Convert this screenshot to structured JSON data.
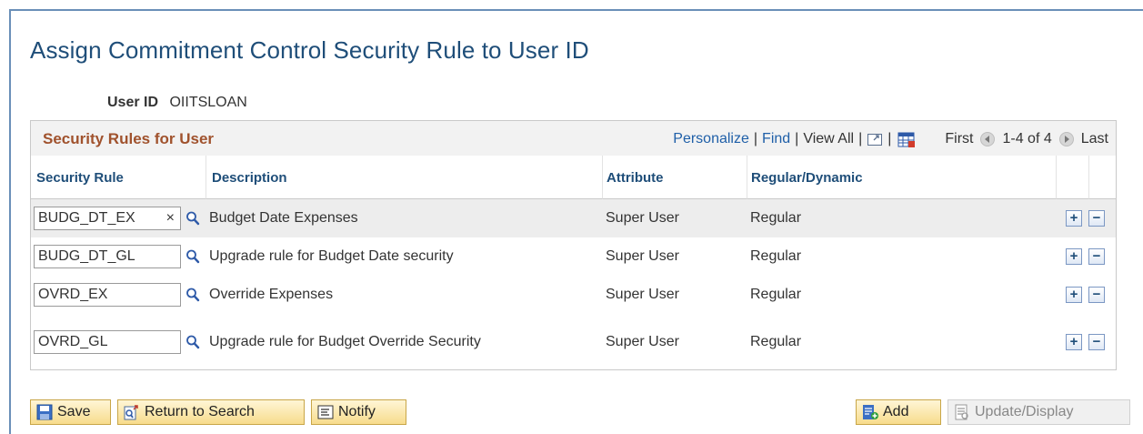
{
  "page": {
    "title": "Assign Commitment Control Security Rule to User ID",
    "user_id_label": "User ID",
    "user_id_value": "OIITSLOAN"
  },
  "grid": {
    "title": "Security Rules for User",
    "nav": {
      "personalize": "Personalize",
      "find": "Find",
      "view_all": "View All",
      "first": "First",
      "range": "1-4 of 4",
      "last": "Last"
    },
    "columns": {
      "security_rule": "Security Rule",
      "description": "Description",
      "attribute": "Attribute",
      "regular_dynamic": "Regular/Dynamic"
    },
    "rows": [
      {
        "rule": "BUDG_DT_EX",
        "description": "Budget Date Expenses",
        "attribute": "Super User",
        "type": "Regular"
      },
      {
        "rule": "BUDG_DT_GL",
        "description": "Upgrade rule for Budget Date security",
        "attribute": "Super User",
        "type": "Regular"
      },
      {
        "rule": "OVRD_EX",
        "description": "Override Expenses",
        "attribute": "Super User",
        "type": "Regular"
      },
      {
        "rule": "OVRD_GL",
        "description": "Upgrade rule for Budget Override Security",
        "attribute": "Super User",
        "type": "Regular"
      }
    ],
    "clear_glyph": "×",
    "add_row_glyph": "+",
    "delete_row_glyph": "−"
  },
  "toolbar": {
    "save": "Save",
    "return_to_search": "Return to Search",
    "notify": "Notify",
    "add": "Add",
    "update_display": "Update/Display"
  },
  "colors": {
    "title": "#1f4e79",
    "grid_title": "#a0522d",
    "link": "#1f5fa8",
    "button_bg": "#f7dc8c"
  }
}
